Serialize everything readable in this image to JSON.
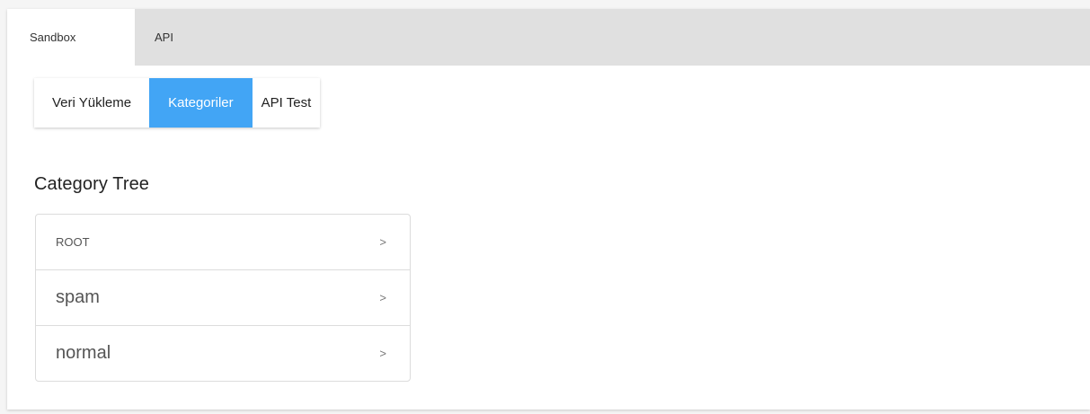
{
  "top_tabs": {
    "sandbox": "Sandbox",
    "api": "API"
  },
  "sub_tabs": {
    "upload": "Veri Yükleme",
    "categories": "Kategoriler",
    "api_test": "API Test"
  },
  "section": {
    "title": "Category Tree"
  },
  "tree": {
    "rows": [
      {
        "label": "ROOT",
        "arrow": ">"
      },
      {
        "label": "spam",
        "arrow": ">"
      },
      {
        "label": "normal",
        "arrow": ">"
      }
    ]
  },
  "colors": {
    "accent": "#42a5f5",
    "tab_bar": "#e0e0e0"
  },
  "icons": {
    "row_arrow": "chevron-right-icon"
  }
}
